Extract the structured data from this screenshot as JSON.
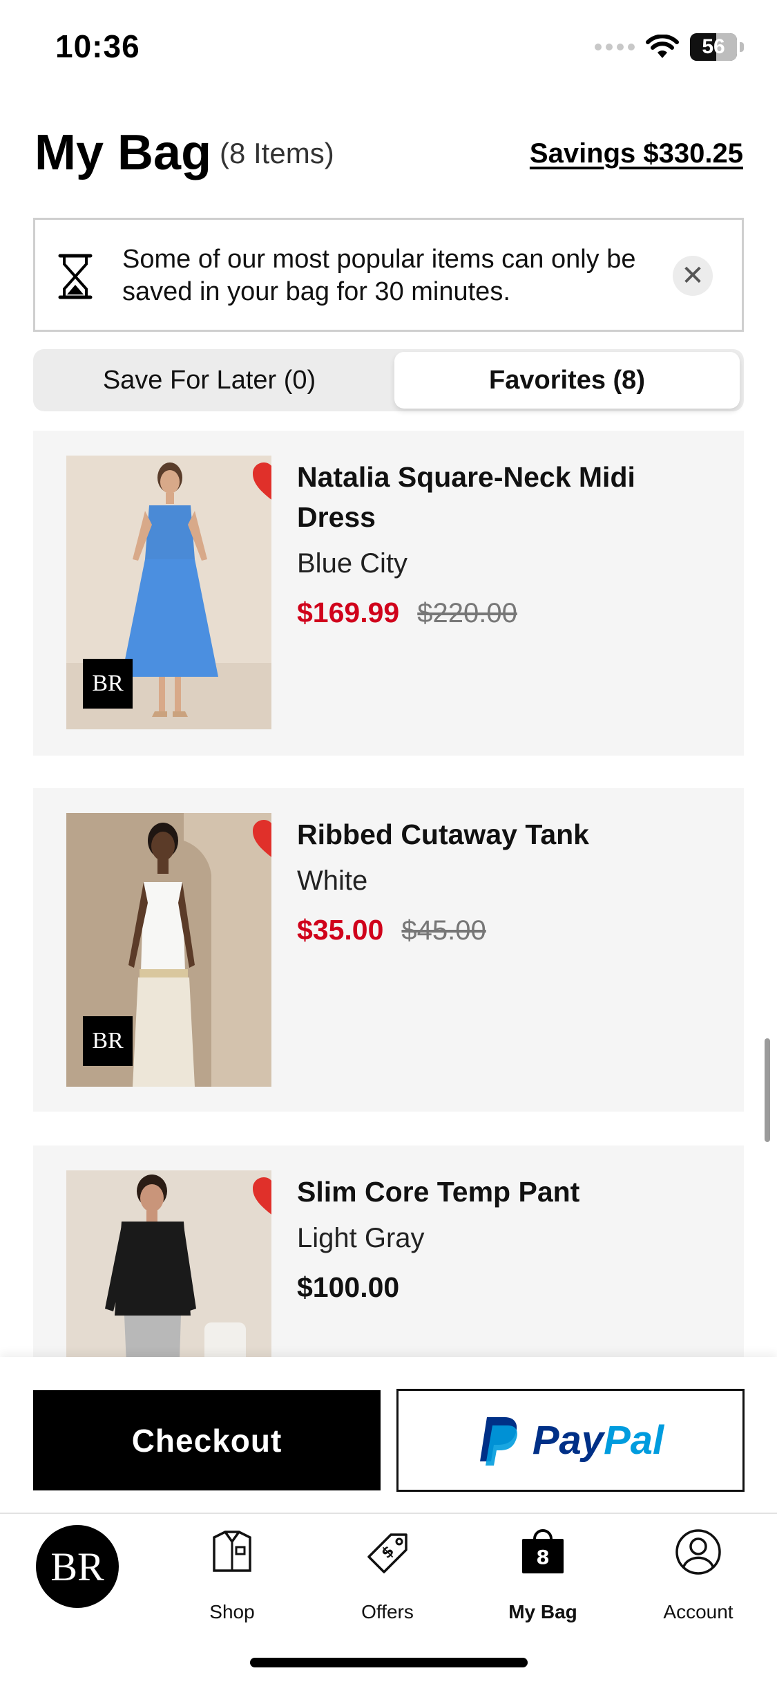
{
  "status_bar": {
    "time": "10:36",
    "battery": "56",
    "battery_level": 0.56
  },
  "header": {
    "title": "My Bag",
    "item_count": "(8 Items)",
    "savings": "Savings $330.25"
  },
  "notice": {
    "text": "Some of our most popular items can only be saved in your bag for 30 minutes.",
    "icon": "hourglass-icon",
    "close_icon": "close-icon"
  },
  "tabs": [
    {
      "label": "Save For Later (0)",
      "selected": false
    },
    {
      "label": "Favorites (8)",
      "selected": true
    }
  ],
  "products": [
    {
      "name": "Natalia Square-Neck Midi Dress",
      "color": "Blue City",
      "sale_price": "$169.99",
      "original_price": "$220.00",
      "favorited": true,
      "badge": "BR"
    },
    {
      "name": "Ribbed Cutaway Tank",
      "color": "White",
      "sale_price": "$35.00",
      "original_price": "$45.00",
      "favorited": true,
      "badge": "BR"
    },
    {
      "name": "Slim Core Temp Pant",
      "color": "Light Gray",
      "price": "$100.00",
      "favorited": true
    }
  ],
  "checkout": {
    "checkout_label": "Checkout",
    "paypal_pay": "Pay",
    "paypal_pal": "Pal"
  },
  "nav": {
    "logo": "BR",
    "items": [
      {
        "label": "Shop",
        "icon": "shirt-icon"
      },
      {
        "label": "Offers",
        "icon": "tag-icon"
      },
      {
        "label": "My Bag",
        "icon": "bag-icon",
        "badge": "8",
        "active": true
      },
      {
        "label": "Account",
        "icon": "account-icon"
      }
    ]
  },
  "colors": {
    "sale_red": "#d0021b",
    "paypal_dark": "#003087",
    "paypal_light": "#009cde",
    "heart_red": "#e0302a"
  }
}
